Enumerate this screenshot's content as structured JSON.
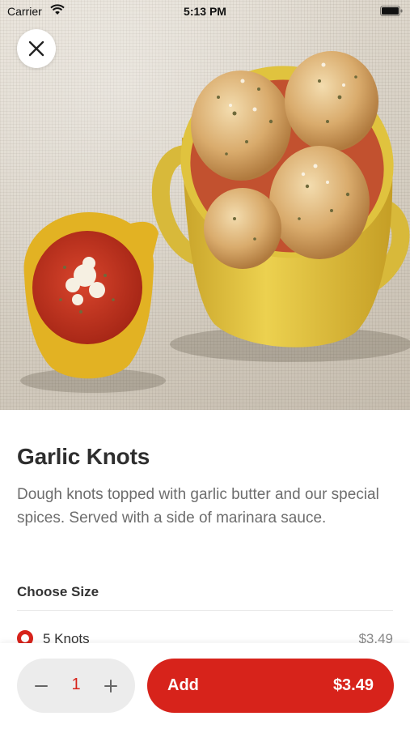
{
  "status_bar": {
    "carrier": "Carrier",
    "time": "5:13 PM",
    "icons": [
      "wifi-icon",
      "battery-icon"
    ]
  },
  "hero": {
    "alt": "Garlic knots in a yellow pot with a cup of marinara sauce"
  },
  "close_button": {
    "icon": "close-icon"
  },
  "item": {
    "title": "Garlic Knots",
    "description": "Dough knots topped with garlic butter and our special spices. Served with a side of marinara sauce."
  },
  "size_section": {
    "heading": "Choose Size",
    "options": [
      {
        "label": "5 Knots",
        "price": "$3.49",
        "selected": true
      }
    ]
  },
  "order": {
    "quantity": "1",
    "minus_icon": "minus-icon",
    "plus_icon": "plus-icon",
    "add_label": "Add",
    "add_price": "$3.49"
  },
  "colors": {
    "accent": "#d7231b",
    "stepper_bg": "#ececec",
    "muted_text": "#6d6d6d"
  }
}
